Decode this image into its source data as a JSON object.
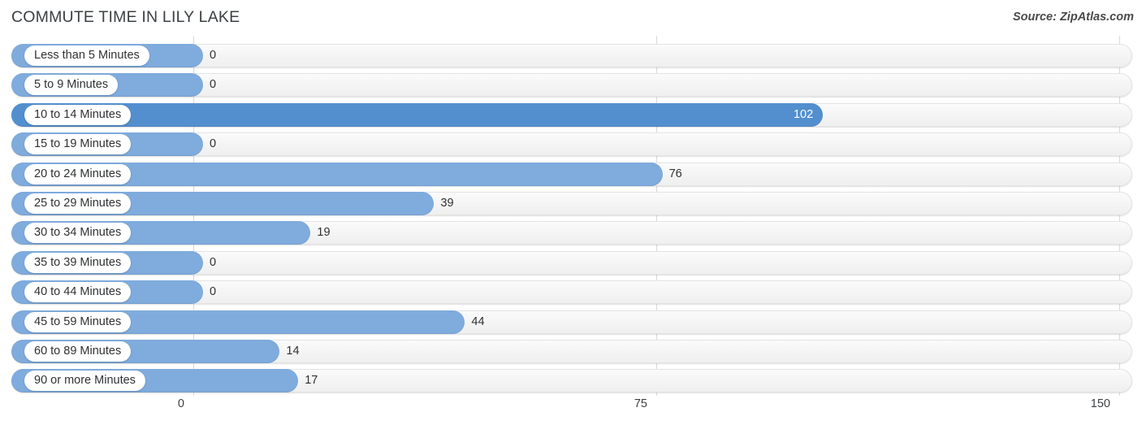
{
  "header": {
    "title": "COMMUTE TIME IN LILY LAKE",
    "source": "Source: ZipAtlas.com"
  },
  "colors": {
    "bar": "#7fabdd",
    "bar_max": "#538fce",
    "track": "#f4f4f4",
    "gridline": "#d9d9d9",
    "text": "#2f3133"
  },
  "chart_data": {
    "type": "bar",
    "orientation": "horizontal",
    "title": "COMMUTE TIME IN LILY LAKE",
    "xlabel": "",
    "ylabel": "",
    "xlim": [
      0,
      150
    ],
    "xticks": [
      "0",
      "75",
      "150"
    ],
    "grid": true,
    "legend": "none",
    "annotation": "Source: ZipAtlas.com",
    "categories": [
      "Less than 5 Minutes",
      "5 to 9 Minutes",
      "10 to 14 Minutes",
      "15 to 19 Minutes",
      "20 to 24 Minutes",
      "25 to 29 Minutes",
      "30 to 34 Minutes",
      "35 to 39 Minutes",
      "40 to 44 Minutes",
      "45 to 59 Minutes",
      "60 to 89 Minutes",
      "90 or more Minutes"
    ],
    "values": [
      0,
      0,
      102,
      0,
      76,
      39,
      19,
      0,
      0,
      44,
      14,
      17
    ],
    "value_labels": [
      "0",
      "0",
      "102",
      "0",
      "76",
      "39",
      "19",
      "0",
      "0",
      "44",
      "14",
      "17"
    ],
    "max_value": 102,
    "max_category": "10 to 14 Minutes"
  }
}
